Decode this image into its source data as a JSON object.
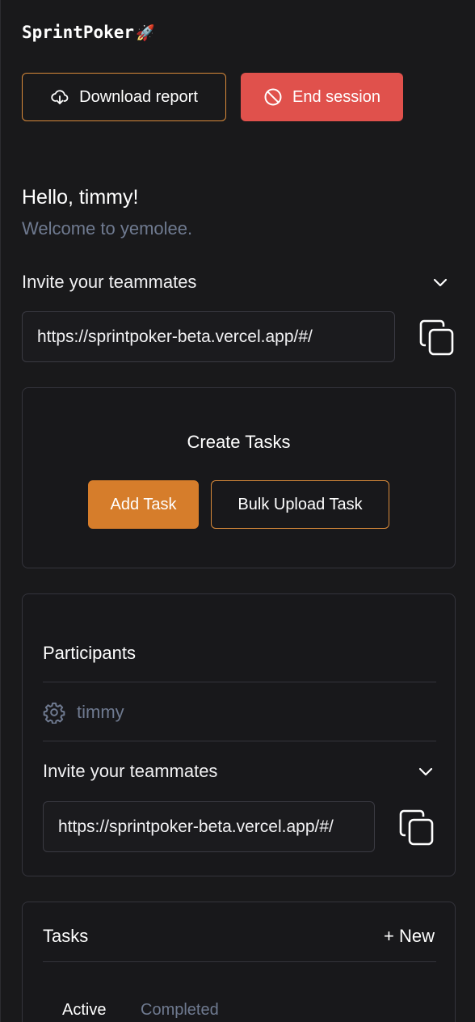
{
  "app": {
    "title": "SprintPoker",
    "logo_emoji": "🚀"
  },
  "toolbar": {
    "download_label": "Download report",
    "end_label": "End session"
  },
  "greeting": {
    "hello": "Hello, timmy!",
    "welcome": "Welcome to yemolee."
  },
  "invite_top": {
    "label": "Invite your teammates",
    "url": "https://sprintpoker-beta.vercel.app/#/"
  },
  "create_tasks": {
    "title": "Create Tasks",
    "add_label": "Add Task",
    "bulk_label": "Bulk Upload Task"
  },
  "participants": {
    "title": "Participants",
    "list": [
      {
        "name": "timmy",
        "icon": "gear-icon"
      }
    ],
    "invite_label": "Invite your teammates",
    "invite_url": "https://sprintpoker-beta.vercel.app/#/"
  },
  "tasks": {
    "title": "Tasks",
    "new_label": "+ New",
    "tabs": [
      {
        "label": "Active",
        "active": true
      },
      {
        "label": "Completed",
        "active": false
      }
    ]
  },
  "colors": {
    "accent": "#d67d2b",
    "danger": "#e0514c",
    "muted": "#6f7a90",
    "background": "#19191b"
  }
}
